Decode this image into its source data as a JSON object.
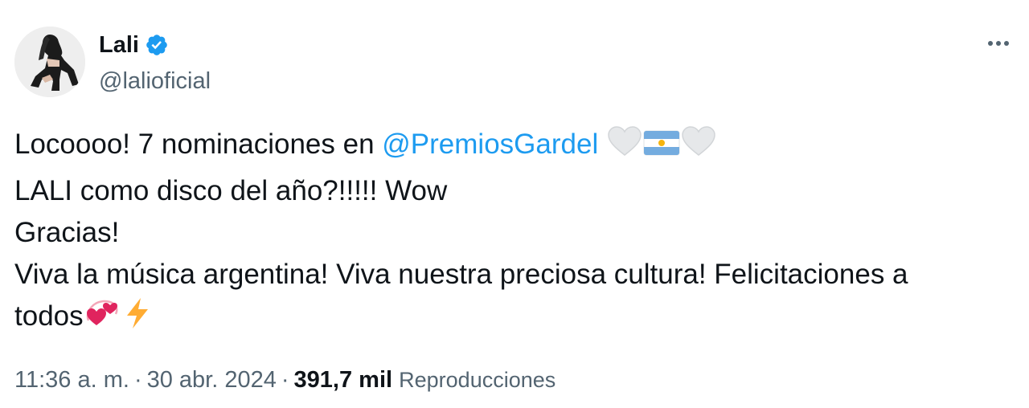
{
  "author": {
    "name": "Lali",
    "handle": "@lalioficial",
    "verified": true,
    "verified_color": "#1d9bf0"
  },
  "menu": {
    "icon": "more-horizontal-icon"
  },
  "tweet": {
    "line1_before": "Locoooo! 7 nominaciones en ",
    "mention": "@PremiosGardel",
    "line1_emojis": [
      "white-heart-icon",
      "argentina-flag-icon",
      "white-heart-icon"
    ],
    "line2": "LALI como disco del año?!!!!! Wow",
    "line3": "Gracias!",
    "line4": "Viva la música argentina! Viva nuestra preciosa cultura! Felicitaciones a",
    "line5": "todos",
    "line5_emojis": [
      "revolving-hearts-icon",
      "lightning-icon"
    ]
  },
  "meta": {
    "time": "11:36 a. m.",
    "separator": "·",
    "date": "30 abr. 2024",
    "views_count": "391,7 mil",
    "views_label": "Reproducciones"
  },
  "colors": {
    "text": "#0f1419",
    "secondary": "#536471",
    "link": "#1d9bf0"
  }
}
